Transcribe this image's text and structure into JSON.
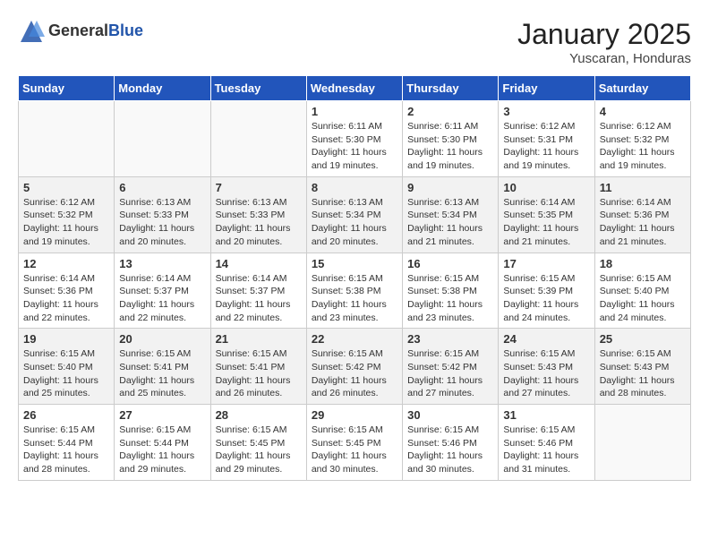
{
  "logo": {
    "general": "General",
    "blue": "Blue"
  },
  "header": {
    "month": "January 2025",
    "location": "Yuscaran, Honduras"
  },
  "weekdays": [
    "Sunday",
    "Monday",
    "Tuesday",
    "Wednesday",
    "Thursday",
    "Friday",
    "Saturday"
  ],
  "weeks": [
    [
      {
        "day": "",
        "info": ""
      },
      {
        "day": "",
        "info": ""
      },
      {
        "day": "",
        "info": ""
      },
      {
        "day": "1",
        "info": "Sunrise: 6:11 AM\nSunset: 5:30 PM\nDaylight: 11 hours and 19 minutes."
      },
      {
        "day": "2",
        "info": "Sunrise: 6:11 AM\nSunset: 5:30 PM\nDaylight: 11 hours and 19 minutes."
      },
      {
        "day": "3",
        "info": "Sunrise: 6:12 AM\nSunset: 5:31 PM\nDaylight: 11 hours and 19 minutes."
      },
      {
        "day": "4",
        "info": "Sunrise: 6:12 AM\nSunset: 5:32 PM\nDaylight: 11 hours and 19 minutes."
      }
    ],
    [
      {
        "day": "5",
        "info": "Sunrise: 6:12 AM\nSunset: 5:32 PM\nDaylight: 11 hours and 19 minutes."
      },
      {
        "day": "6",
        "info": "Sunrise: 6:13 AM\nSunset: 5:33 PM\nDaylight: 11 hours and 20 minutes."
      },
      {
        "day": "7",
        "info": "Sunrise: 6:13 AM\nSunset: 5:33 PM\nDaylight: 11 hours and 20 minutes."
      },
      {
        "day": "8",
        "info": "Sunrise: 6:13 AM\nSunset: 5:34 PM\nDaylight: 11 hours and 20 minutes."
      },
      {
        "day": "9",
        "info": "Sunrise: 6:13 AM\nSunset: 5:34 PM\nDaylight: 11 hours and 21 minutes."
      },
      {
        "day": "10",
        "info": "Sunrise: 6:14 AM\nSunset: 5:35 PM\nDaylight: 11 hours and 21 minutes."
      },
      {
        "day": "11",
        "info": "Sunrise: 6:14 AM\nSunset: 5:36 PM\nDaylight: 11 hours and 21 minutes."
      }
    ],
    [
      {
        "day": "12",
        "info": "Sunrise: 6:14 AM\nSunset: 5:36 PM\nDaylight: 11 hours and 22 minutes."
      },
      {
        "day": "13",
        "info": "Sunrise: 6:14 AM\nSunset: 5:37 PM\nDaylight: 11 hours and 22 minutes."
      },
      {
        "day": "14",
        "info": "Sunrise: 6:14 AM\nSunset: 5:37 PM\nDaylight: 11 hours and 22 minutes."
      },
      {
        "day": "15",
        "info": "Sunrise: 6:15 AM\nSunset: 5:38 PM\nDaylight: 11 hours and 23 minutes."
      },
      {
        "day": "16",
        "info": "Sunrise: 6:15 AM\nSunset: 5:38 PM\nDaylight: 11 hours and 23 minutes."
      },
      {
        "day": "17",
        "info": "Sunrise: 6:15 AM\nSunset: 5:39 PM\nDaylight: 11 hours and 24 minutes."
      },
      {
        "day": "18",
        "info": "Sunrise: 6:15 AM\nSunset: 5:40 PM\nDaylight: 11 hours and 24 minutes."
      }
    ],
    [
      {
        "day": "19",
        "info": "Sunrise: 6:15 AM\nSunset: 5:40 PM\nDaylight: 11 hours and 25 minutes."
      },
      {
        "day": "20",
        "info": "Sunrise: 6:15 AM\nSunset: 5:41 PM\nDaylight: 11 hours and 25 minutes."
      },
      {
        "day": "21",
        "info": "Sunrise: 6:15 AM\nSunset: 5:41 PM\nDaylight: 11 hours and 26 minutes."
      },
      {
        "day": "22",
        "info": "Sunrise: 6:15 AM\nSunset: 5:42 PM\nDaylight: 11 hours and 26 minutes."
      },
      {
        "day": "23",
        "info": "Sunrise: 6:15 AM\nSunset: 5:42 PM\nDaylight: 11 hours and 27 minutes."
      },
      {
        "day": "24",
        "info": "Sunrise: 6:15 AM\nSunset: 5:43 PM\nDaylight: 11 hours and 27 minutes."
      },
      {
        "day": "25",
        "info": "Sunrise: 6:15 AM\nSunset: 5:43 PM\nDaylight: 11 hours and 28 minutes."
      }
    ],
    [
      {
        "day": "26",
        "info": "Sunrise: 6:15 AM\nSunset: 5:44 PM\nDaylight: 11 hours and 28 minutes."
      },
      {
        "day": "27",
        "info": "Sunrise: 6:15 AM\nSunset: 5:44 PM\nDaylight: 11 hours and 29 minutes."
      },
      {
        "day": "28",
        "info": "Sunrise: 6:15 AM\nSunset: 5:45 PM\nDaylight: 11 hours and 29 minutes."
      },
      {
        "day": "29",
        "info": "Sunrise: 6:15 AM\nSunset: 5:45 PM\nDaylight: 11 hours and 30 minutes."
      },
      {
        "day": "30",
        "info": "Sunrise: 6:15 AM\nSunset: 5:46 PM\nDaylight: 11 hours and 30 minutes."
      },
      {
        "day": "31",
        "info": "Sunrise: 6:15 AM\nSunset: 5:46 PM\nDaylight: 11 hours and 31 minutes."
      },
      {
        "day": "",
        "info": ""
      }
    ]
  ]
}
